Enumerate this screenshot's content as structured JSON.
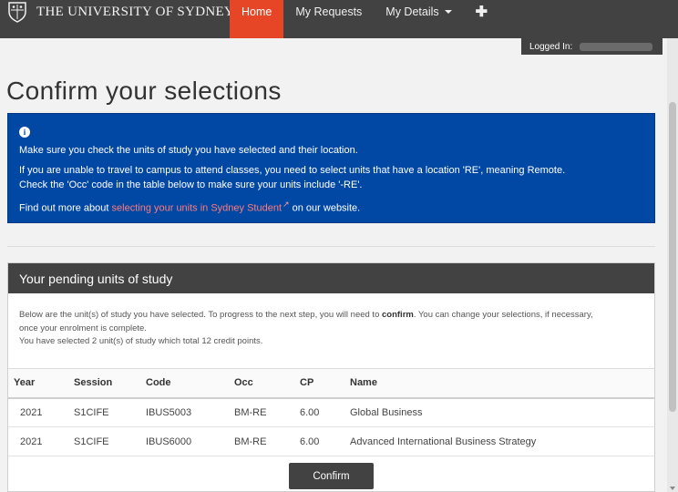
{
  "header": {
    "brand_name": "THE UNIVERSITY OF SYDNEY",
    "nav": [
      {
        "label": "Home"
      },
      {
        "label": "My Requests"
      },
      {
        "label": "My Details"
      }
    ],
    "logged_in_label": "Logged In:"
  },
  "page": {
    "title": "Confirm your selections"
  },
  "alert": {
    "line1": "Make sure you check the units of study you have selected and their location.",
    "line2a": "If you are unable to travel to campus to attend classes, you need to select units that have a location 'RE', meaning Remote.",
    "line2b": "Check the 'Occ' code in the table below to make sure your units include '-RE'.",
    "line3_prefix": "Find out more about ",
    "line3_link": "selecting your units in Sydney Student",
    "line3_suffix": " on our website."
  },
  "panel": {
    "title": "Your pending units of study",
    "intro_a": "Below are the unit(s) of study you have selected. To progress to the next step, you will need to ",
    "intro_bold": "confirm",
    "intro_b": ". You can change your selections, if necessary,",
    "intro_c": "once your enrolment is complete.",
    "intro_d": "You have selected 2 unit(s) of study which total 12 credit points.",
    "columns": [
      "Year",
      "Session",
      "Code",
      "Occ",
      "CP",
      "Name"
    ],
    "rows": [
      [
        "2021",
        "S1CIFE",
        "IBUS5003",
        "BM-RE",
        "6.00",
        "Global Business"
      ],
      [
        "2021",
        "S1CIFE",
        "IBUS6000",
        "BM-RE",
        "6.00",
        "Advanced International Business Strategy"
      ]
    ],
    "confirm_label": "Confirm"
  }
}
